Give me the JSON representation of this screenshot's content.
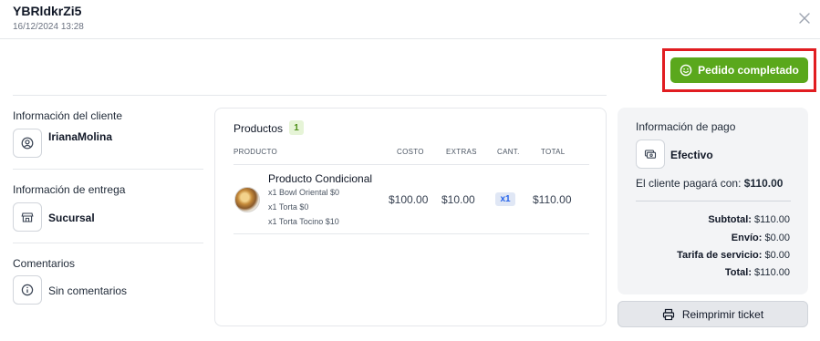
{
  "header": {
    "order_id": "YBRldkrZi5",
    "date": "16/12/2024 13:28"
  },
  "status_button": {
    "label": "Pedido completado",
    "color": "#5aa81c"
  },
  "client": {
    "title": "Información del cliente",
    "name": "IrianaMolina",
    "icon": "user-circle-icon"
  },
  "delivery": {
    "title": "Información de entrega",
    "value": "Sucursal",
    "icon": "store-icon"
  },
  "comments": {
    "title": "Comentarios",
    "value": "Sin comentarios",
    "icon": "info-icon"
  },
  "products": {
    "title": "Productos",
    "count": "1",
    "columns": {
      "product": "PRODUCTO",
      "cost": "COSTO",
      "extras": "EXTRAS",
      "qty": "CANT.",
      "total": "TOTAL"
    },
    "items": [
      {
        "name": "Producto Condicional",
        "options": [
          "x1 Bowl Oriental $0",
          "x1 Torta $0",
          "x1 Torta Tocino $10"
        ],
        "cost": "$100.00",
        "extras": "$10.00",
        "qty": "x1",
        "total": "$110.00"
      }
    ]
  },
  "payment": {
    "title": "Información de pago",
    "method": "Efectivo",
    "will_pay_label": "El cliente pagará con:",
    "will_pay_amount": "$110.00",
    "subtotal_label": "Subtotal:",
    "subtotal": "$110.00",
    "shipping_label": "Envío:",
    "shipping": "$0.00",
    "service_label": "Tarifa de servicio:",
    "service": "$0.00",
    "total_label": "Total:",
    "total": "$110.00"
  },
  "reprint_button": {
    "label": "Reimprimir ticket"
  },
  "colors": {
    "accent_green": "#5aa81c",
    "highlight_red": "#e11d21",
    "qty_badge_blue": "#2563eb"
  }
}
